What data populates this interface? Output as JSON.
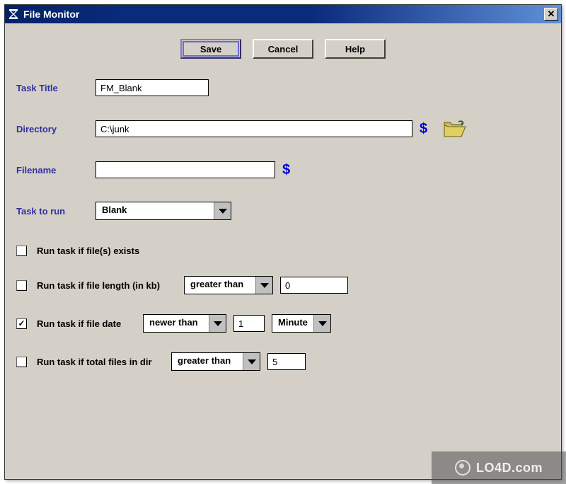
{
  "window": {
    "title": "File Monitor"
  },
  "buttons": {
    "save": "Save",
    "cancel": "Cancel",
    "help": "Help"
  },
  "labels": {
    "task_title": "Task Title",
    "directory": "Directory",
    "filename": "Filename",
    "task_to_run": "Task to run"
  },
  "values": {
    "task_title": "FM_Blank",
    "directory": "C:\\junk",
    "filename": "",
    "task_to_run": "Blank"
  },
  "checks": {
    "exists": {
      "label": "Run task if file(s) exists",
      "checked": false
    },
    "length": {
      "label": "Run task if file length (in kb)",
      "checked": false,
      "op": "greater than",
      "value": "0"
    },
    "date": {
      "label": "Run task if file date",
      "checked": true,
      "op": "newer than",
      "value": "1",
      "unit": "Minute"
    },
    "total": {
      "label": "Run task if total files in dir",
      "checked": false,
      "op": "greater than",
      "value": "5"
    }
  },
  "icons": {
    "dollar": "$",
    "close": "✕"
  },
  "watermark": "LO4D.com"
}
